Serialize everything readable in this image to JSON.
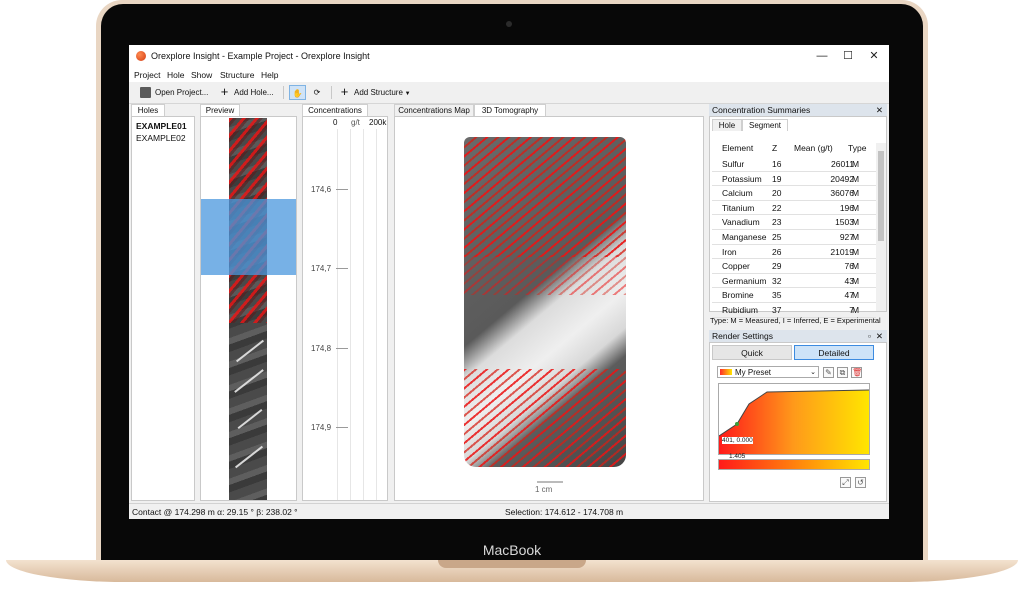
{
  "device": {
    "brand": "MacBook"
  },
  "window": {
    "title": "Orexplore Insight - Example Project - Orexplore Insight",
    "minimize": "—",
    "maximize": "☐",
    "close": "✕"
  },
  "menu": [
    "Project",
    "Hole",
    "Show",
    "Structure",
    "Help"
  ],
  "toolbar": {
    "open_project": "Open Project...",
    "add_hole": "Add Hole...",
    "add_structure": "Add Structure",
    "hand_icon": "hand-pan-icon",
    "rotate_icon": "rotate-icon"
  },
  "holes": {
    "tab": "Holes",
    "items": [
      "EXAMPLE01",
      "EXAMPLE02"
    ],
    "selected": "EXAMPLE01"
  },
  "preview": {
    "tab": "Preview"
  },
  "concentrations": {
    "tab": "Concentrations",
    "axis_min": "0",
    "axis_unit": "g/t",
    "axis_max": "200k",
    "depths": [
      "174,6",
      "174,7",
      "174,8",
      "174,9"
    ]
  },
  "viewer": {
    "tabs": [
      "Concentrations Map",
      "3D Tomography"
    ],
    "active_tab": "3D Tomography",
    "scale_label": "1 cm"
  },
  "summaries": {
    "title": "Concentration Summaries",
    "tabs": [
      "Hole",
      "Segment"
    ],
    "active_tab": "Segment",
    "columns": [
      "Element",
      "Z",
      "Mean (g/t)",
      "Type"
    ],
    "rows": [
      [
        "Sulfur",
        "16",
        "26011",
        "M"
      ],
      [
        "Potassium",
        "19",
        "20492",
        "M"
      ],
      [
        "Calcium",
        "20",
        "36076",
        "M"
      ],
      [
        "Titanium",
        "22",
        "196",
        "M"
      ],
      [
        "Vanadium",
        "23",
        "1503",
        "M"
      ],
      [
        "Manganese",
        "25",
        "927",
        "M"
      ],
      [
        "Iron",
        "26",
        "21019",
        "M"
      ],
      [
        "Copper",
        "29",
        "76",
        "M"
      ],
      [
        "Germanium",
        "32",
        "43",
        "M"
      ],
      [
        "Bromine",
        "35",
        "47",
        "M"
      ],
      [
        "Rubidium",
        "37",
        "7",
        "M"
      ]
    ],
    "legend": "Type: M = Measured, I = Inferred, E = Experimental"
  },
  "render": {
    "title": "Render Settings",
    "modes": [
      "Quick",
      "Detailed"
    ],
    "active_mode": "Detailed",
    "preset": "My Preset",
    "point_label": "401, 0.000",
    "bar_label": "1.405"
  },
  "status": {
    "contact": "Contact @ 174.298 m α: 29.15 ° β: 238.02 °",
    "selection": "Selection: 174.612 - 174.708 m"
  },
  "colors": {
    "accent": "#4a97de",
    "ore_red": "#e81414",
    "gradient_start": "#ff2a2a",
    "gradient_end": "#ffe600"
  }
}
